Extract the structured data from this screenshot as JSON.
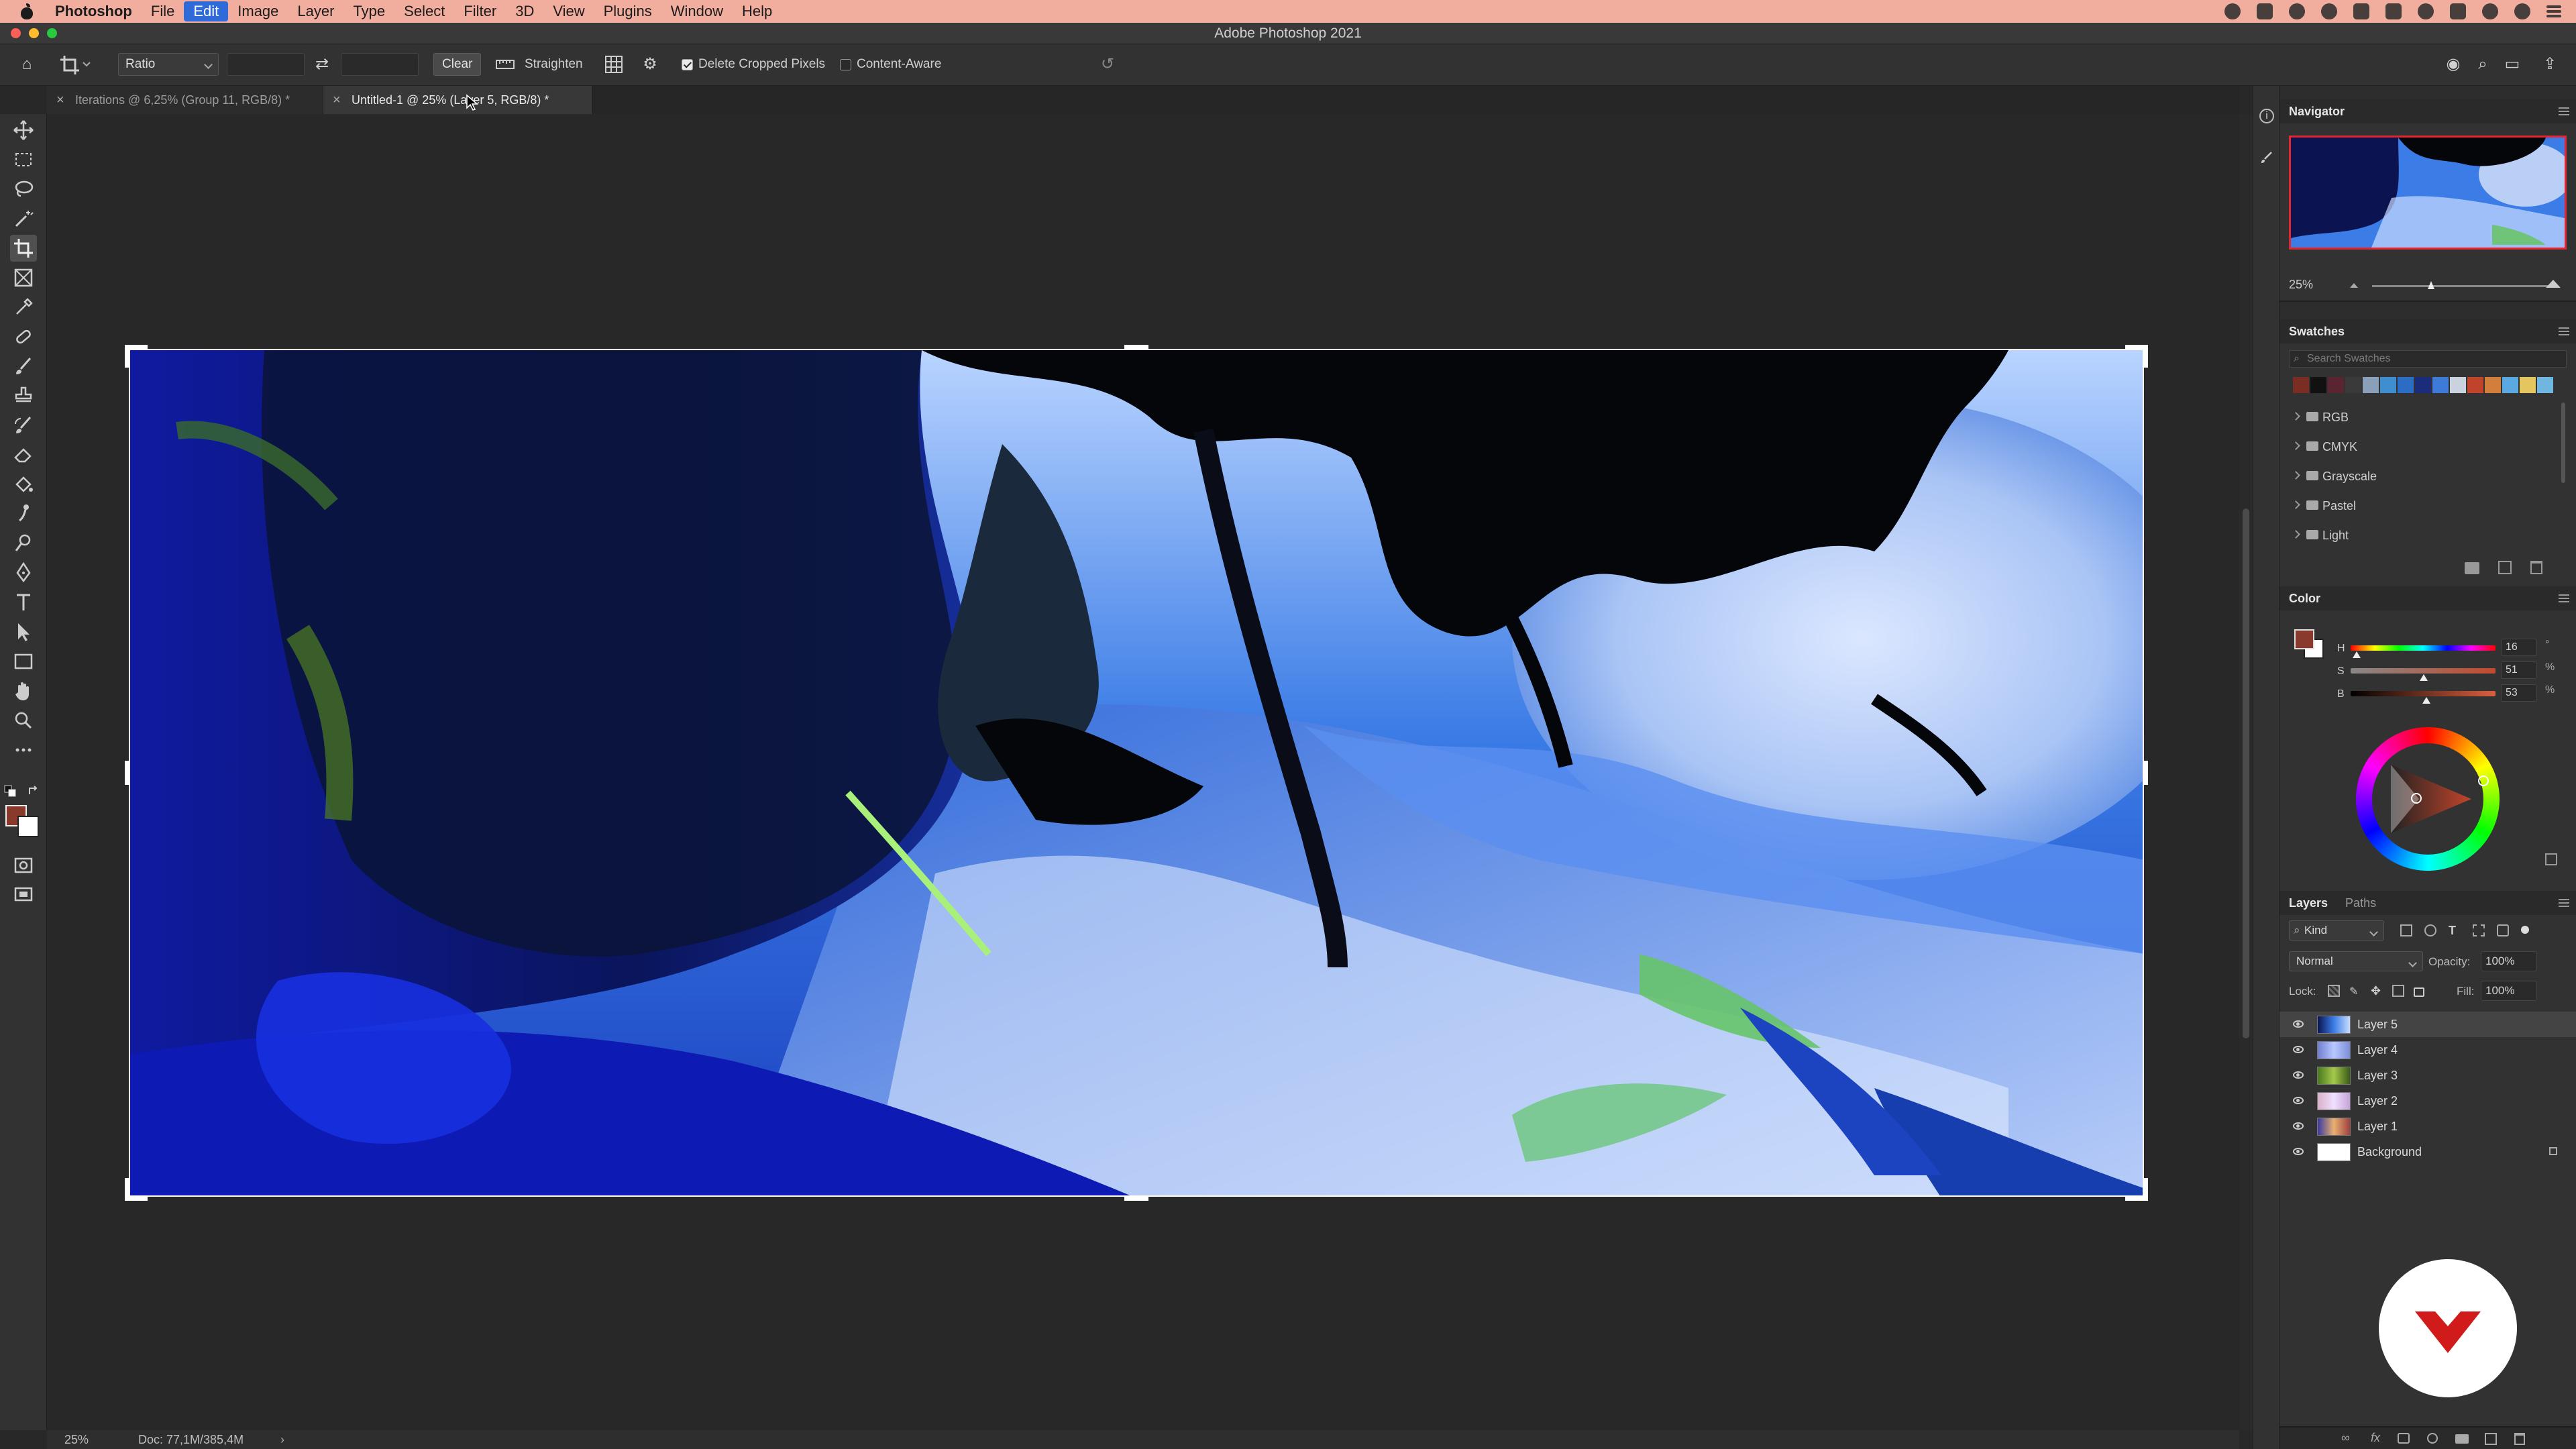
{
  "menubar": {
    "app": "Photoshop",
    "items": [
      "File",
      "Edit",
      "Image",
      "Layer",
      "Type",
      "Select",
      "Filter",
      "3D",
      "View",
      "Plugins",
      "Window",
      "Help"
    ],
    "active": "Edit"
  },
  "window": {
    "title": "Adobe Photoshop 2021"
  },
  "options": {
    "ratio": "Ratio",
    "clear": "Clear",
    "straighten": "Straighten",
    "delete_cropped": "Delete Cropped Pixels",
    "delete_cropped_checked": true,
    "content_aware": "Content-Aware",
    "content_aware_checked": false
  },
  "tabs": [
    {
      "label": "Iterations @ 6,25% (Group 11, RGB/8) *",
      "active": false
    },
    {
      "label": "Untitled-1 @ 25% (Layer 5, RGB/8) *",
      "active": true
    }
  ],
  "status": {
    "zoom": "25%",
    "doc": "Doc: 77,1M/385,4M"
  },
  "navigator": {
    "title": "Navigator",
    "zoom": "25%"
  },
  "swatches": {
    "title": "Swatches",
    "search_placeholder": "Search Swatches",
    "colors": [
      "#7a2e23",
      "#111111",
      "#5a2431",
      "#3a3a3a",
      "#8aa0b8",
      "#3f8fd0",
      "#2b6cc4",
      "#1a2c7a",
      "#3e7bd8",
      "#c9d3e0",
      "#c0442c",
      "#d37e3a",
      "#5aa9e0",
      "#e3c660",
      "#6fb6e0"
    ],
    "groups": [
      "RGB",
      "CMYK",
      "Grayscale",
      "Pastel",
      "Light"
    ]
  },
  "color": {
    "title": "Color",
    "h_label": "H",
    "s_label": "S",
    "b_label": "B",
    "h": "16",
    "s": "51",
    "b": "53",
    "pct": "%",
    "deg": "°",
    "fg": "#8a3a2c"
  },
  "layers": {
    "tabs": [
      "Layers",
      "Paths"
    ],
    "kind": "Kind",
    "blend": "Normal",
    "opacity_label": "Opacity:",
    "opacity": "100%",
    "lock_label": "Lock:",
    "fill_label": "Fill:",
    "fill": "100%",
    "items": [
      {
        "name": "Layer 5",
        "selected": true
      },
      {
        "name": "Layer 4",
        "selected": false
      },
      {
        "name": "Layer 3",
        "selected": false
      },
      {
        "name": "Layer 2",
        "selected": false
      },
      {
        "name": "Layer 1",
        "selected": false
      },
      {
        "name": "Background",
        "selected": false,
        "locked": true
      }
    ]
  }
}
